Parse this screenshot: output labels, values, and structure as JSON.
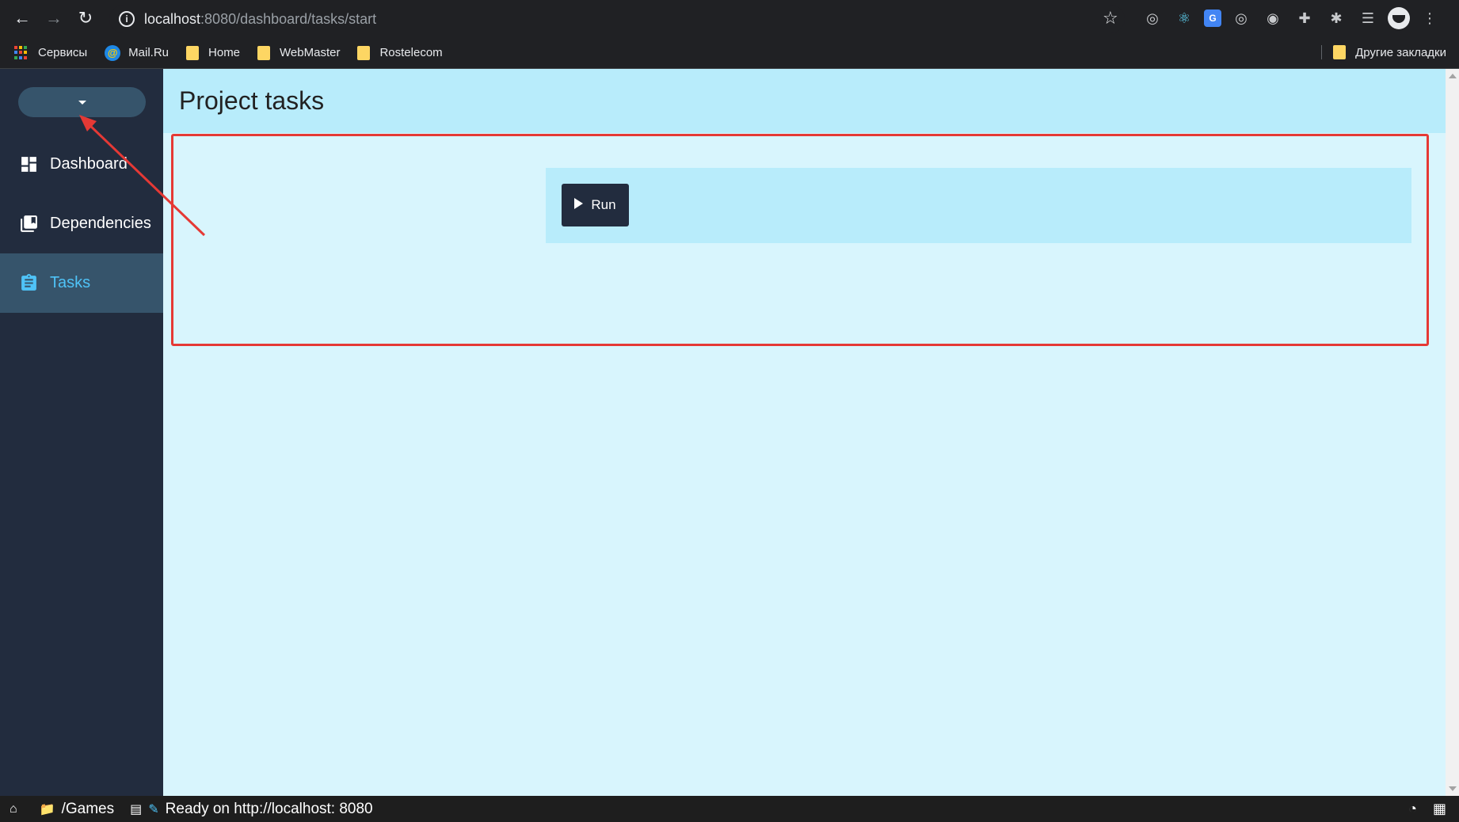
{
  "browser": {
    "url_host": "localhost",
    "url_path": ":8080/dashboard/tasks/start"
  },
  "bookmarks": {
    "items": [
      {
        "label": "Сервисы",
        "icon": "apps-icon"
      },
      {
        "label": "Mail.Ru",
        "icon": "mailru-icon"
      },
      {
        "label": "Home",
        "icon": "folder-icon"
      },
      {
        "label": "WebMaster",
        "icon": "folder-icon"
      },
      {
        "label": "Rostelecom",
        "icon": "folder-icon"
      }
    ],
    "other_label": "Другие закладки"
  },
  "sidebar": {
    "items": [
      {
        "label": "Dashboard",
        "icon": "dashboard-icon",
        "active": false
      },
      {
        "label": "Dependencies",
        "icon": "library-icon",
        "active": false
      },
      {
        "label": "Tasks",
        "icon": "clipboard-icon",
        "active": true
      }
    ]
  },
  "main": {
    "title": "Project tasks",
    "run_label": "Run"
  },
  "statusbar": {
    "folder": "/Games",
    "status": "Ready on http://localhost: 8080"
  },
  "colors": {
    "sidebar_bg": "#222c3e",
    "active_bg": "#36546b",
    "active_text": "#4fc3f7",
    "header_bg": "#b8ecfb",
    "content_bg": "#d8f5fd",
    "annotation": "#e53935"
  }
}
